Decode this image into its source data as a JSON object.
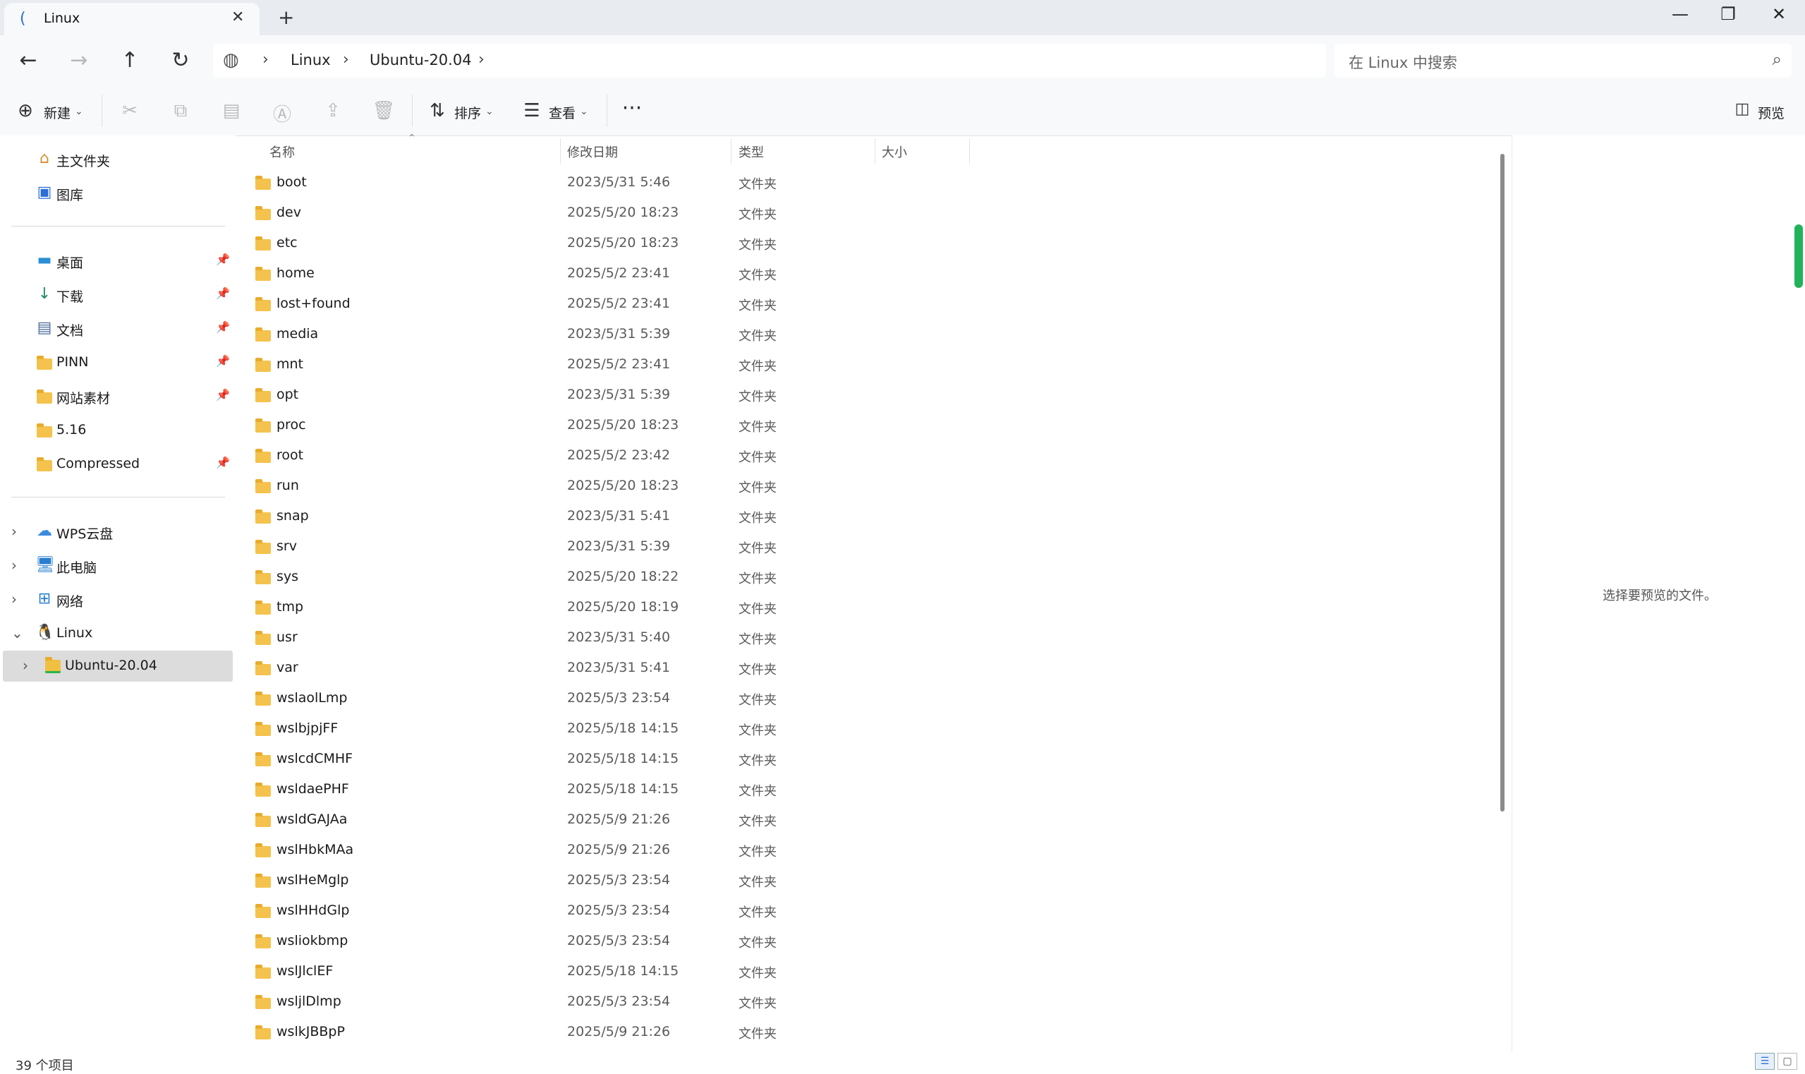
{
  "tab": {
    "title": "Linux",
    "icon": "linux-tab-icon"
  },
  "breadcrumb": [
    "Linux",
    "Ubuntu-20.04"
  ],
  "search": {
    "placeholder": "在 Linux 中搜索"
  },
  "toolbar": {
    "new_label": "新建",
    "sort_label": "排序",
    "view_label": "查看",
    "preview_label": "预览"
  },
  "sidebar": {
    "top": [
      {
        "label": "主文件夹",
        "icon": "home-icon"
      },
      {
        "label": "图库",
        "icon": "gallery-icon"
      }
    ],
    "quick": [
      {
        "label": "桌面",
        "icon": "desktop-icon",
        "pinned": true
      },
      {
        "label": "下载",
        "icon": "download-icon",
        "pinned": true
      },
      {
        "label": "文档",
        "icon": "document-icon",
        "pinned": true
      },
      {
        "label": "PINN",
        "icon": "folder-icon",
        "pinned": true
      },
      {
        "label": "网站素材",
        "icon": "folder-icon",
        "pinned": true
      },
      {
        "label": "5.16",
        "icon": "folder-icon",
        "pinned": false
      },
      {
        "label": "Compressed",
        "icon": "folder-icon",
        "pinned": true
      }
    ],
    "tree": [
      {
        "label": "WPS云盘",
        "icon": "cloud-icon"
      },
      {
        "label": "此电脑",
        "icon": "computer-icon"
      },
      {
        "label": "网络",
        "icon": "network-icon"
      },
      {
        "label": "Linux",
        "icon": "linux-icon"
      },
      {
        "label": "Ubuntu-20.04",
        "icon": "ubuntu-folder-icon"
      }
    ]
  },
  "columns": {
    "name": "名称",
    "modified": "修改日期",
    "type": "类型",
    "size": "大小"
  },
  "files": [
    {
      "name": "boot",
      "date": "2023/5/31 5:46",
      "type": "文件夹"
    },
    {
      "name": "dev",
      "date": "2025/5/20 18:23",
      "type": "文件夹"
    },
    {
      "name": "etc",
      "date": "2025/5/20 18:23",
      "type": "文件夹"
    },
    {
      "name": "home",
      "date": "2025/5/2 23:41",
      "type": "文件夹"
    },
    {
      "name": "lost+found",
      "date": "2025/5/2 23:41",
      "type": "文件夹"
    },
    {
      "name": "media",
      "date": "2023/5/31 5:39",
      "type": "文件夹"
    },
    {
      "name": "mnt",
      "date": "2025/5/2 23:41",
      "type": "文件夹"
    },
    {
      "name": "opt",
      "date": "2023/5/31 5:39",
      "type": "文件夹"
    },
    {
      "name": "proc",
      "date": "2025/5/20 18:23",
      "type": "文件夹"
    },
    {
      "name": "root",
      "date": "2025/5/2 23:42",
      "type": "文件夹"
    },
    {
      "name": "run",
      "date": "2025/5/20 18:23",
      "type": "文件夹"
    },
    {
      "name": "snap",
      "date": "2023/5/31 5:41",
      "type": "文件夹"
    },
    {
      "name": "srv",
      "date": "2023/5/31 5:39",
      "type": "文件夹"
    },
    {
      "name": "sys",
      "date": "2025/5/20 18:22",
      "type": "文件夹"
    },
    {
      "name": "tmp",
      "date": "2025/5/20 18:19",
      "type": "文件夹"
    },
    {
      "name": "usr",
      "date": "2023/5/31 5:40",
      "type": "文件夹"
    },
    {
      "name": "var",
      "date": "2023/5/31 5:41",
      "type": "文件夹"
    },
    {
      "name": "wslaolLmp",
      "date": "2025/5/3 23:54",
      "type": "文件夹"
    },
    {
      "name": "wslbjpjFF",
      "date": "2025/5/18 14:15",
      "type": "文件夹"
    },
    {
      "name": "wslcdCMHF",
      "date": "2025/5/18 14:15",
      "type": "文件夹"
    },
    {
      "name": "wsldaePHF",
      "date": "2025/5/18 14:15",
      "type": "文件夹"
    },
    {
      "name": "wsldGAJAa",
      "date": "2025/5/9 21:26",
      "type": "文件夹"
    },
    {
      "name": "wslHbkMAa",
      "date": "2025/5/9 21:26",
      "type": "文件夹"
    },
    {
      "name": "wslHeMglp",
      "date": "2025/5/3 23:54",
      "type": "文件夹"
    },
    {
      "name": "wslHHdGlp",
      "date": "2025/5/3 23:54",
      "type": "文件夹"
    },
    {
      "name": "wsliokbmp",
      "date": "2025/5/3 23:54",
      "type": "文件夹"
    },
    {
      "name": "wslJlclEF",
      "date": "2025/5/18 14:15",
      "type": "文件夹"
    },
    {
      "name": "wsljlDlmp",
      "date": "2025/5/3 23:54",
      "type": "文件夹"
    },
    {
      "name": "wslkJBBpP",
      "date": "2025/5/9 21:26",
      "type": "文件夹"
    }
  ],
  "preview": {
    "message": "选择要预览的文件。"
  },
  "status": {
    "count": "39 个项目"
  }
}
